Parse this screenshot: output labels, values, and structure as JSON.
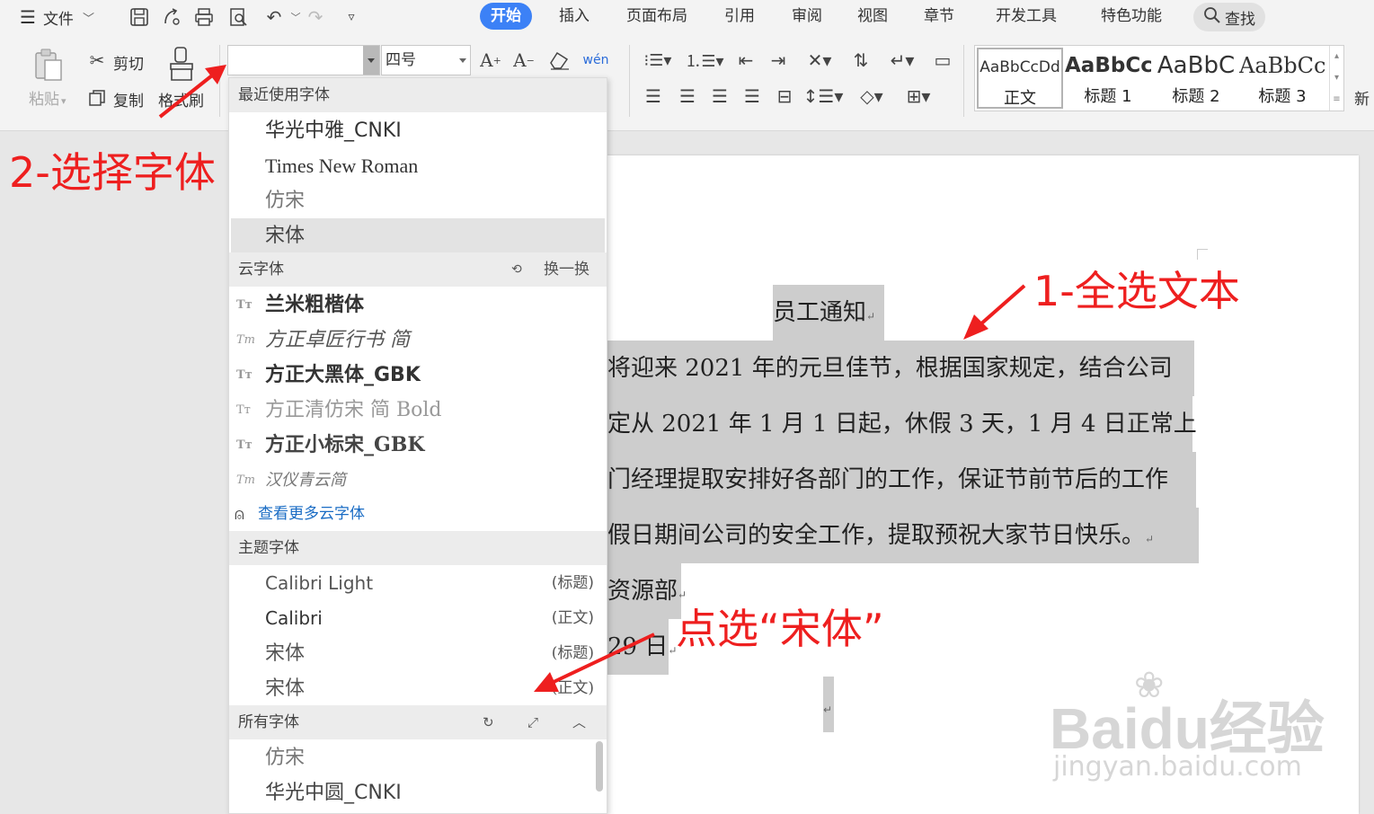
{
  "topbar": {
    "file_label": "文件",
    "tabs": [
      "开始",
      "插入",
      "页面布局",
      "引用",
      "审阅",
      "视图",
      "章节",
      "开发工具",
      "特色功能"
    ],
    "active_tab": "开始",
    "search_label": "查找"
  },
  "ribbon": {
    "paste_label": "粘贴",
    "cut_label": "剪切",
    "copy_label": "复制",
    "format_painter_label": "格式刷",
    "font_name_value": "",
    "font_size_value": "四号",
    "styles": [
      {
        "sample": "AaBbCcDd",
        "label": "正文"
      },
      {
        "sample": "AaBbCc",
        "label": "标题 1"
      },
      {
        "sample": "AaBbC",
        "label": "标题 2"
      },
      {
        "sample": "AaBbCcI",
        "label": "标题 3"
      }
    ],
    "new_style_label": "新"
  },
  "font_dropdown": {
    "recent": {
      "header": "最近使用字体",
      "items": [
        "华光中雅_CNKI",
        "Times New Roman",
        "仿宋",
        "宋体"
      ],
      "highlighted": "宋体"
    },
    "cloud": {
      "header": "云字体",
      "action": "换一换",
      "items": [
        "兰米粗楷体",
        "方正卓匠行书 简",
        "方正大黑体_GBK",
        "方正清仿宋 简 Bold",
        "方正小标宋_GBK",
        "汉仪青云简"
      ],
      "more_link": "查看更多云字体"
    },
    "theme": {
      "header": "主题字体",
      "items": [
        {
          "name": "Calibri Light",
          "tag": "(标题)"
        },
        {
          "name": "Calibri",
          "tag": "(正文)"
        },
        {
          "name": "宋体",
          "tag": "(标题)"
        },
        {
          "name": "宋体",
          "tag": "(正文)"
        }
      ]
    },
    "all": {
      "header": "所有字体",
      "items": [
        "仿宋",
        "华光中圆_CNKI"
      ]
    }
  },
  "document": {
    "title": "员工通知",
    "lines": [
      "将迎来 2021 年的元旦佳节，根据国家规定，结合公司",
      "定从 2021 年 1 月 1 日起，休假 3 天，1 月 4 日正常上",
      "门经理提取安排好各部门的工作，保证节前节后的工作",
      "假日期间公司的安全工作，提取预祝大家节日快乐。",
      "资源部",
      "29 日"
    ]
  },
  "annotations": {
    "step1": "1-全选文本",
    "step2": "2-选择字体",
    "step3": "点选“宋体”"
  },
  "watermark": {
    "brand": "Baidu经验",
    "url": "jingyan.baidu.com"
  },
  "colors": {
    "accent": "#3c81f6",
    "annotation": "#ee1f1f",
    "selection": "#cdcdcd"
  }
}
